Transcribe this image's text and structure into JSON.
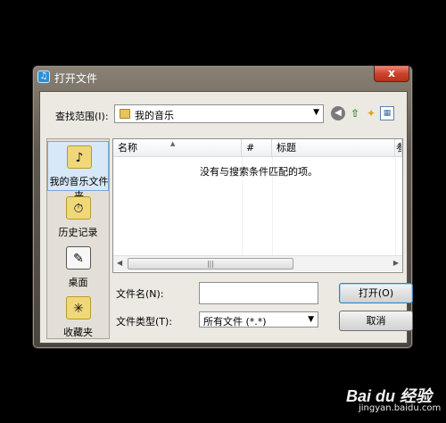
{
  "window": {
    "title": "打开文件",
    "close_glyph": "x"
  },
  "toolbar": {
    "lookin_label": "查找范围(I):",
    "lookin_value": "我的音乐",
    "back_glyph": "◀",
    "up_glyph": "⇧",
    "newfolder_glyph": "✦",
    "views_glyph": "▦"
  },
  "places": [
    {
      "label": "我的音乐文件夹",
      "icon": "music-folder-icon",
      "glyph": "♪"
    },
    {
      "label": "历史记录",
      "icon": "history-icon",
      "glyph": "⏱"
    },
    {
      "label": "桌面",
      "icon": "desktop-icon",
      "glyph": "✎"
    },
    {
      "label": "收藏夹",
      "icon": "favorites-icon",
      "glyph": "✳"
    }
  ],
  "filelist": {
    "columns": [
      "名称",
      "#",
      "标题",
      "参"
    ],
    "empty_message": "没有与搜索条件匹配的项。"
  },
  "fields": {
    "filename_label": "文件名(N):",
    "filename_value": "",
    "filetype_label": "文件类型(T):",
    "filetype_value": "所有文件 (*.*)"
  },
  "buttons": {
    "open": "打开(O)",
    "cancel": "取消"
  },
  "watermark": {
    "logo": "Bai du 经验",
    "url": "jingyan.baidu.com"
  }
}
